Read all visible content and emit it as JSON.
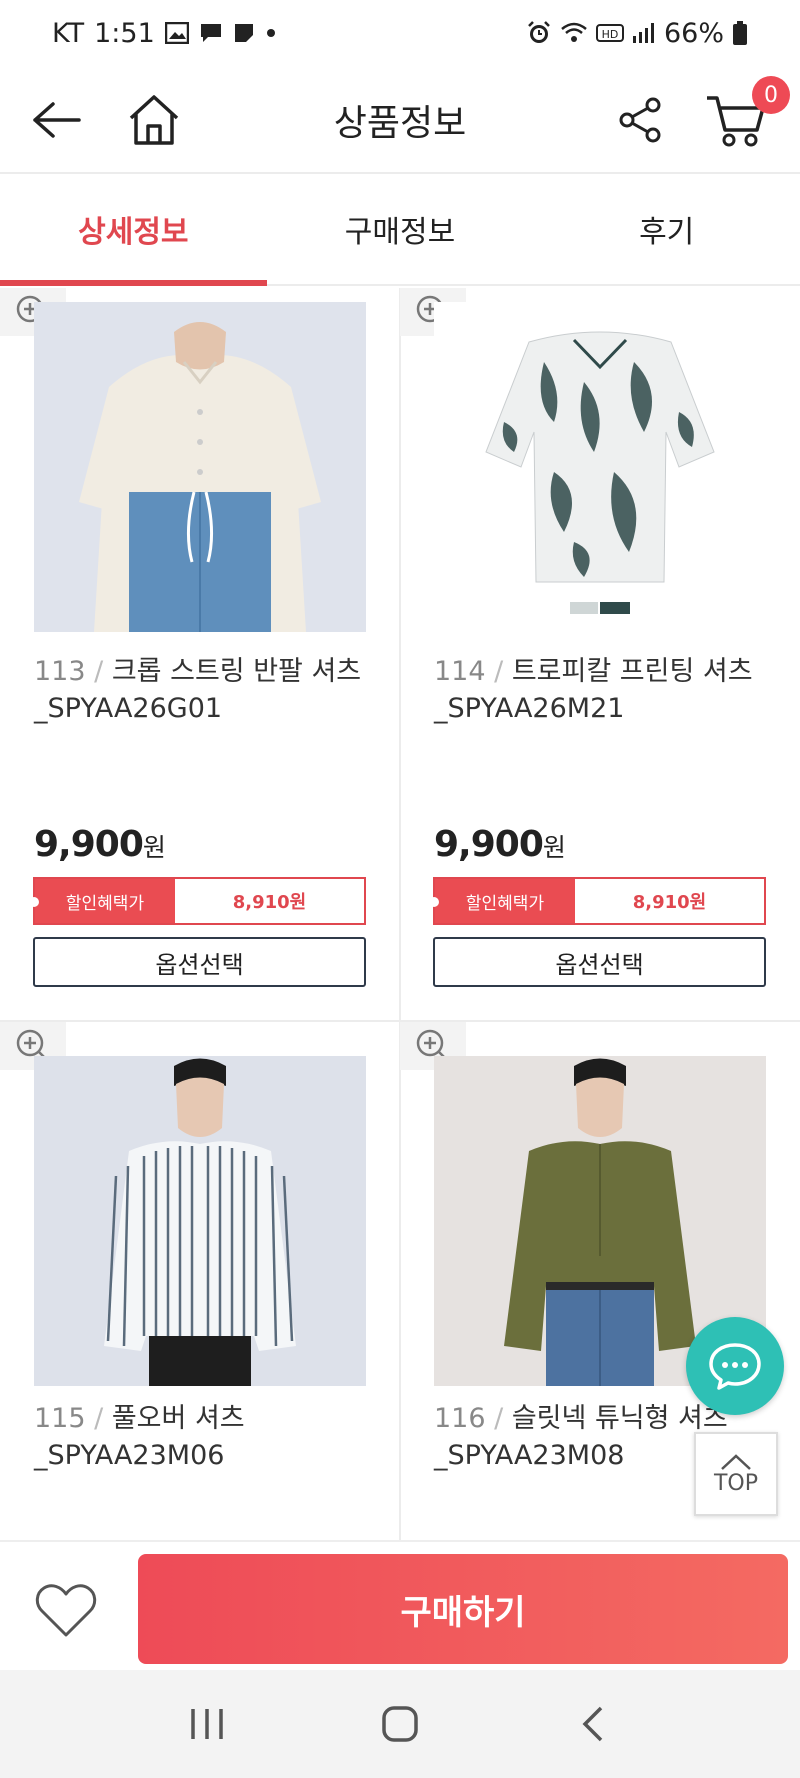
{
  "status_bar": {
    "carrier": "KT",
    "time": "1:51",
    "battery": "66%"
  },
  "header": {
    "title": "상품정보",
    "cart_count": "0"
  },
  "tabs": [
    {
      "label": "상세정보",
      "active": true
    },
    {
      "label": "구매정보",
      "active": false
    },
    {
      "label": "후기",
      "active": false
    }
  ],
  "products": [
    {
      "number": "113",
      "separator": "/",
      "name": "크롭 스트링 반팔 셔츠_SPYAA26G01",
      "price": "9,900",
      "currency": "원",
      "discount_label": "할인혜택가",
      "discount_price": "8,910원",
      "option_label": "옵션선택"
    },
    {
      "number": "114",
      "separator": "/",
      "name": "트로피칼 프린팅 셔츠_SPYAA26M21",
      "price": "9,900",
      "currency": "원",
      "discount_label": "할인혜택가",
      "discount_price": "8,910원",
      "option_label": "옵션선택"
    },
    {
      "number": "115",
      "separator": "/",
      "name": "풀오버 셔츠_SPYAA23M06"
    },
    {
      "number": "116",
      "separator": "/",
      "name": "슬릿넥 튜닉형 셔츠_SPYAA23M08"
    }
  ],
  "floating": {
    "top_label": "TOP"
  },
  "action_bar": {
    "buy_label": "구매하기"
  },
  "colors": {
    "accent": "#e0474f",
    "chat": "#2ec0b5",
    "buy_gradient_start": "#ee4b57",
    "buy_gradient_end": "#f46a62"
  }
}
